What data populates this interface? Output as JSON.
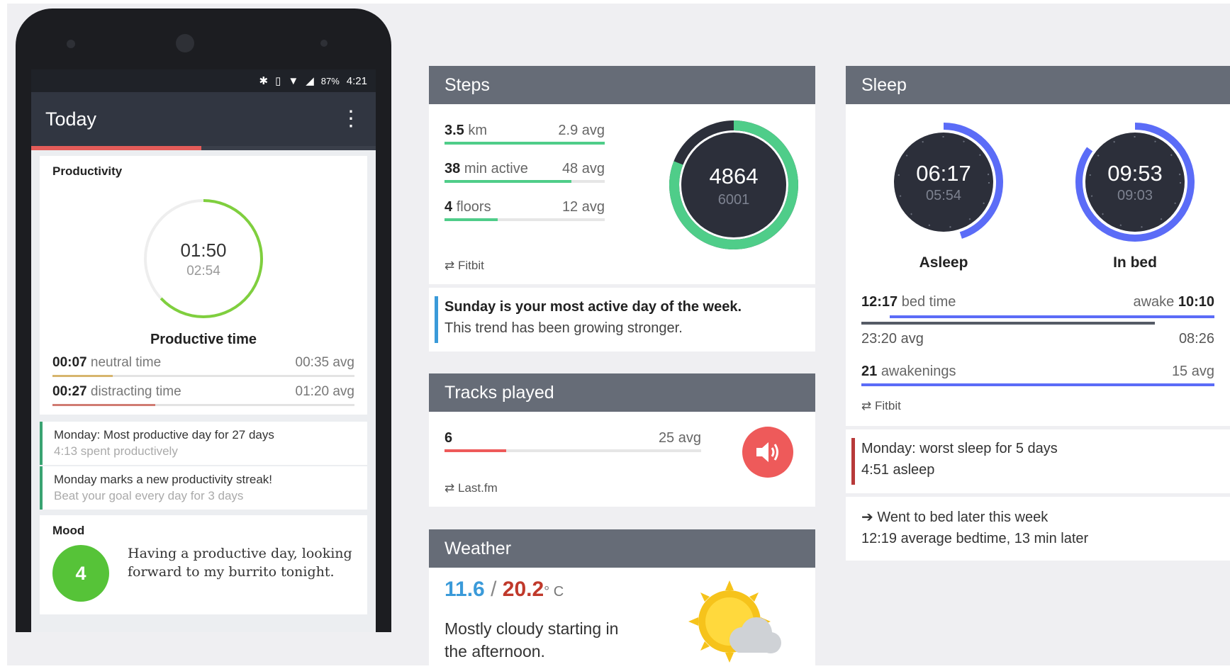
{
  "phone": {
    "status": {
      "bluetooth_icon": "bluetooth-icon",
      "vibrate_icon": "vibrate-icon",
      "battery": "87%",
      "time": "4:21"
    },
    "app": {
      "title": "Today",
      "menu_icon": "more-vert-icon"
    },
    "productivity": {
      "title": "Productivity",
      "time": "01:50",
      "avg": "02:54",
      "caption": "Productive time",
      "progress": 0.63,
      "rows": [
        {
          "value": "00:07",
          "label": "neutral time",
          "avg": "00:35 avg",
          "fill": 0.2,
          "color": "#d7b56d"
        },
        {
          "value": "00:27",
          "label": "distracting time",
          "avg": "01:20 avg",
          "fill": 0.34,
          "color": "#d07b72"
        }
      ]
    },
    "notes": [
      {
        "line1": "Monday: Most productive day for 27 days",
        "line2": "4:13 spent productively"
      },
      {
        "line1": "Monday marks a new productivity streak!",
        "line2": "Beat your goal every day for 3 days"
      }
    ],
    "mood": {
      "title": "Mood",
      "score": "4",
      "text": "Having a productive day, looking forward to my burrito tonight."
    }
  },
  "steps": {
    "title": "Steps",
    "rows": [
      {
        "value": "3.5",
        "unit": "km",
        "avg": "2.9 avg",
        "fill": 1.0
      },
      {
        "value": "38",
        "unit": "min active",
        "avg": "48 avg",
        "fill": 0.79
      },
      {
        "value": "4",
        "unit": "floors",
        "avg": "12 avg",
        "fill": 0.33
      }
    ],
    "source": "Fitbit",
    "count": "4864",
    "goal": "6001",
    "progress": 0.81,
    "insight": {
      "bold": "Sunday is your most active day of the week.",
      "text": "This trend has been growing stronger."
    }
  },
  "tracks": {
    "title": "Tracks played",
    "value": "6",
    "avg": "25 avg",
    "fill": 0.24,
    "source": "Last.fm",
    "icon": "volume-icon"
  },
  "weather": {
    "title": "Weather",
    "low": "11.6",
    "sep": "/",
    "high": "20.2",
    "unit": "° C",
    "desc": "Mostly cloudy starting in the afternoon.",
    "icon": "partly-sunny-icon"
  },
  "sleep": {
    "title": "Sleep",
    "asleep": {
      "time": "06:17",
      "avg": "05:54",
      "label": "Asleep",
      "progress": 0.45
    },
    "inbed": {
      "time": "09:53",
      "avg": "09:03",
      "label": "In bed",
      "progress": 0.85
    },
    "bedtime": {
      "value": "12:17",
      "label": "bed time",
      "awake_label": "awake",
      "awake": "10:10"
    },
    "avg_bed": "23:20 avg",
    "avg_wake": "08:26",
    "awakenings": {
      "value": "21",
      "label": "awakenings",
      "avg": "15 avg"
    },
    "source": "Fitbit",
    "insight1": {
      "line1": "Monday: worst sleep for 5 days",
      "line2": "4:51 asleep"
    },
    "insight2": {
      "line1": "Went to bed later this week",
      "line2": "12:19 average bedtime, 13 min later"
    }
  },
  "colors": {
    "green": "#4fcd89",
    "blue": "#5b6cf7",
    "red": "#ee5a5a",
    "header": "#666c77"
  }
}
